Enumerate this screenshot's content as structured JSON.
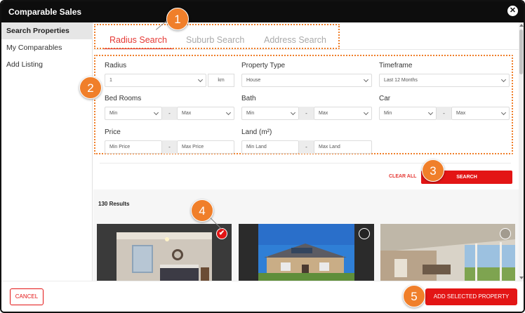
{
  "window": {
    "title": "Comparable Sales",
    "close_glyph": "✕"
  },
  "sidebar": {
    "items": [
      {
        "label": "Search Properties",
        "active": true
      },
      {
        "label": "My Comparables"
      },
      {
        "label": "Add Listing"
      }
    ]
  },
  "tabs": [
    {
      "label": "Radius Search",
      "active": true
    },
    {
      "label": "Suburb Search"
    },
    {
      "label": "Address Search"
    }
  ],
  "filters": {
    "radius": {
      "label": "Radius",
      "value": "1",
      "unit": "km"
    },
    "property_type": {
      "label": "Property Type",
      "value": "House"
    },
    "timeframe": {
      "label": "Timeframe",
      "value": "Last 12 Months"
    },
    "bedrooms": {
      "label": "Bed Rooms",
      "min": "Min",
      "max": "Max"
    },
    "bath": {
      "label": "Bath",
      "min": "Min",
      "max": "Max"
    },
    "car": {
      "label": "Car",
      "min": "Min",
      "max": "Max"
    },
    "price": {
      "label": "Price",
      "min_placeholder": "Min Price",
      "max_placeholder": "Max Price"
    },
    "land": {
      "label": "Land (m²)",
      "min_placeholder": "Min Land",
      "max_placeholder": "Max Land"
    },
    "range_separator": "-"
  },
  "actions": {
    "clear_all": "CLEAR ALL",
    "search": "SEARCH"
  },
  "results": {
    "count_text": "130 Results",
    "cards": [
      {
        "selected": true
      },
      {
        "selected": false
      },
      {
        "selected": false
      }
    ],
    "check_glyph": "✔"
  },
  "footer": {
    "cancel": "CANCEL",
    "add_selected": "ADD SELECTED PROPERTY"
  },
  "badges": [
    "1",
    "2",
    "3",
    "4",
    "5"
  ],
  "colors": {
    "accent": "#e31515",
    "highlight": "#f07f2a",
    "titlebar": "#0d0d0d"
  }
}
